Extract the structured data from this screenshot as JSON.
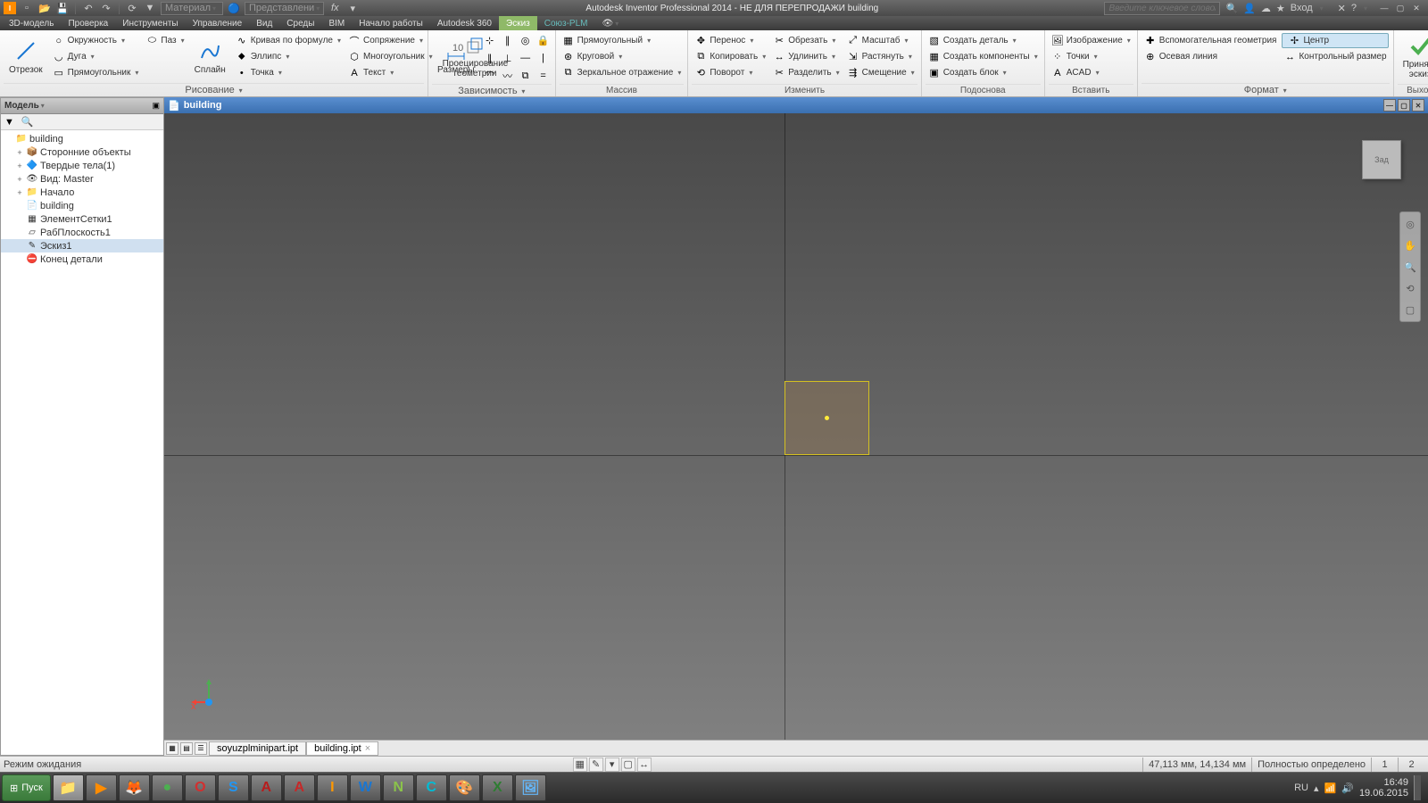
{
  "title": "Autodesk Inventor Professional 2014 - НЕ ДЛЯ ПЕРЕПРОДАЖИ    building",
  "search_ph": "Введите ключевое слово/фразу",
  "login": "Вход",
  "qat_dd1": "Материал",
  "qat_dd2": "Представлени",
  "menu": [
    "3D-модель",
    "Проверка",
    "Инструменты",
    "Управление",
    "Вид",
    "Среды",
    "BIM",
    "Начало работы",
    "Autodesk 360",
    "Эскиз",
    "Союз-PLM"
  ],
  "menu_active": 9,
  "ribbon": {
    "p1": {
      "title": "Рисование",
      "big": [
        {
          "l": "Отрезок"
        },
        {
          "l": "Сплайн"
        },
        {
          "l": "Проецирование\nгеометрии"
        }
      ],
      "col1": [
        "Окружность",
        "Дуга",
        "Прямоугольник"
      ],
      "col2": [
        "Паз"
      ],
      "col3": [
        "Кривая по формуле",
        "Эллипс",
        "Точка"
      ],
      "col4": [
        "Сопряжение",
        "Многоугольник",
        "Текст"
      ]
    },
    "p2": {
      "title": "Зависимость",
      "big": "Размеры"
    },
    "p3": {
      "title": "Массив",
      "rows": [
        "Прямоугольный",
        "Круговой",
        "Зеркальное отражение"
      ]
    },
    "p4": {
      "title": "Изменить",
      "c1": [
        "Перенос",
        "Копировать",
        "Поворот"
      ],
      "c2": [
        "Обрезать",
        "Удлинить",
        "Разделить"
      ],
      "c3": [
        "Масштаб",
        "Растянуть",
        "Смещение"
      ]
    },
    "p5": {
      "title": "Подоснова",
      "rows": [
        "Создать деталь",
        "Создать компоненты",
        "Создать блок"
      ]
    },
    "p6": {
      "title": "Вставить",
      "rows": [
        "Изображение",
        "Точки",
        "ACAD"
      ]
    },
    "p7": {
      "title": "Формат",
      "r1": "Вспомогательная геометрия",
      "r2": "Осевая линия",
      "r3": "Центр",
      "r4": "Контрольный размер"
    },
    "p8": {
      "title": "Выход",
      "big": "Принять\nэскиз"
    }
  },
  "tree_hdr": "Модель",
  "tree": [
    {
      "l": "building",
      "ico": "📁",
      "ind": 0,
      "exp": ""
    },
    {
      "l": "Сторонние объекты",
      "ico": "📦",
      "ind": 1,
      "exp": "+"
    },
    {
      "l": "Твердые тела(1)",
      "ico": "🔷",
      "ind": 1,
      "exp": "+"
    },
    {
      "l": "Вид: Master",
      "ico": "👁",
      "ind": 1,
      "exp": "+"
    },
    {
      "l": "Начало",
      "ico": "📁",
      "ind": 1,
      "exp": "+"
    },
    {
      "l": "building",
      "ico": "📄",
      "ind": 1,
      "exp": ""
    },
    {
      "l": "ЭлементСетки1",
      "ico": "▦",
      "ind": 1,
      "exp": ""
    },
    {
      "l": "РабПлоскость1",
      "ico": "▱",
      "ind": 1,
      "exp": ""
    },
    {
      "l": "Эскиз1",
      "ico": "✎",
      "ind": 1,
      "exp": "",
      "sel": true
    },
    {
      "l": "Конец детали",
      "ico": "⛔",
      "ind": 1,
      "exp": ""
    }
  ],
  "doc_title": "building",
  "viewcube": "Зад",
  "tabs": [
    "soyuzplminipart.ipt",
    "building.ipt"
  ],
  "active_tab": 1,
  "status_left": "Режим ожидания",
  "status_coord": "47,113 мм,  14,134 мм",
  "status_constr": "Полностью определено",
  "status_n1": "1",
  "status_n2": "2",
  "start": "Пуск",
  "lang": "RU",
  "time": "16:49",
  "date": "19.06.2015",
  "tb_apps": [
    {
      "c": "#f5d76e",
      "t": "📁"
    },
    {
      "c": "#ff8c00",
      "t": "▶"
    },
    {
      "c": "#ff6a00",
      "t": "🦊"
    },
    {
      "c": "#4caf50",
      "t": "●"
    },
    {
      "c": "#d32f2f",
      "t": "O"
    },
    {
      "c": "#2196f3",
      "t": "S"
    },
    {
      "c": "#b71c1c",
      "t": "A"
    },
    {
      "c": "#c62828",
      "t": "A"
    },
    {
      "c": "#ff9800",
      "t": "I"
    },
    {
      "c": "#1976d2",
      "t": "W"
    },
    {
      "c": "#8bc34a",
      "t": "N"
    },
    {
      "c": "#00bcd4",
      "t": "C"
    },
    {
      "c": "#ffb74d",
      "t": "🎨"
    },
    {
      "c": "#2e7d32",
      "t": "X"
    },
    {
      "c": "#64b5f6",
      "t": "🖼"
    }
  ]
}
